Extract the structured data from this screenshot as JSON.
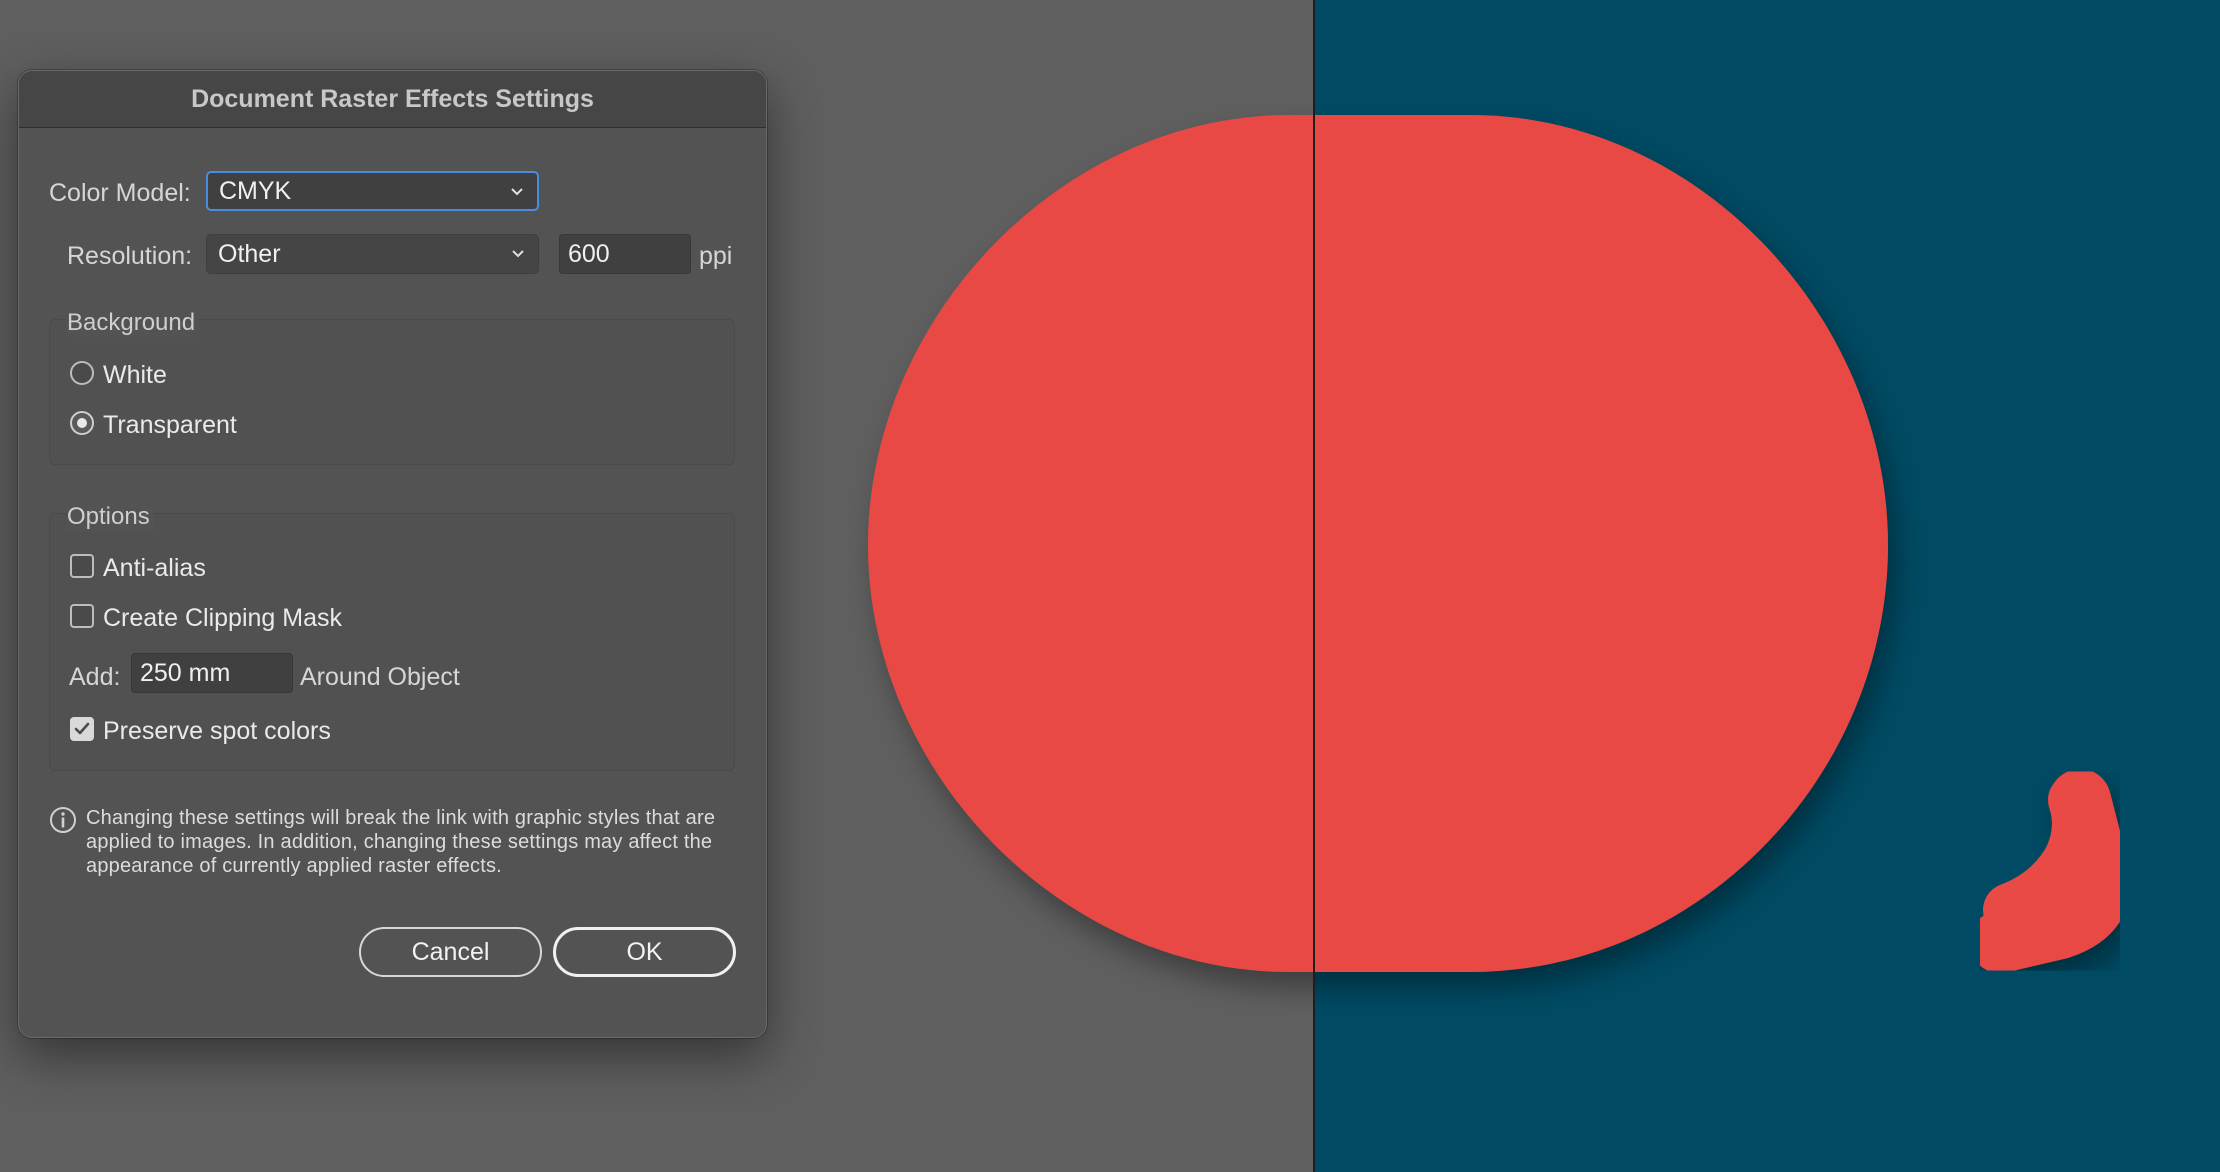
{
  "dialog": {
    "title": "Document Raster Effects Settings",
    "color_model": {
      "label": "Color Model:",
      "value": "CMYK"
    },
    "resolution": {
      "label": "Resolution:",
      "value": "Other",
      "ppi_value": "600",
      "unit": "ppi"
    },
    "background": {
      "title": "Background",
      "options": [
        {
          "label": "White",
          "selected": false
        },
        {
          "label": "Transparent",
          "selected": true
        }
      ]
    },
    "options": {
      "title": "Options",
      "anti_alias": {
        "label": "Anti-alias",
        "checked": false
      },
      "clipping_mask": {
        "label": "Create Clipping Mask",
        "checked": false
      },
      "add": {
        "label": "Add:",
        "value": "250 mm",
        "suffix": "Around Object"
      },
      "preserve_spot": {
        "label": "Preserve spot colors",
        "checked": true
      }
    },
    "info": "Changing these settings will break the link with graphic styles that are applied to images. In addition, changing these settings may affect the appearance of currently applied raster effects.",
    "buttons": {
      "cancel": "Cancel",
      "ok": "OK"
    }
  },
  "colors": {
    "workspace": "#5f5f5f",
    "artboard": "#004a63",
    "shape": "#e94a45",
    "accent": "#4a8de0"
  }
}
